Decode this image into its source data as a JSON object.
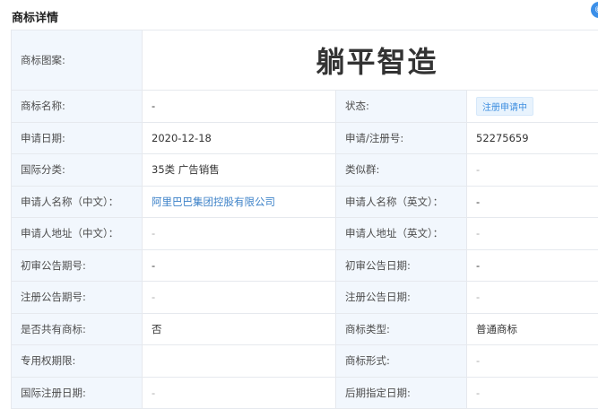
{
  "header": {
    "title": "商标详情",
    "corner_icon": "info-icon"
  },
  "trademark_image": {
    "label": "商标图案:",
    "text": "躺平智造"
  },
  "rows": [
    {
      "l1": "商标名称:",
      "v1": "-",
      "l2": "状态:",
      "v2": "注册申请中"
    },
    {
      "l1": "申请日期:",
      "v1": "2020-12-18",
      "l2": "申请/注册号:",
      "v2": "52275659"
    },
    {
      "l1": "国际分类:",
      "v1": "35类 广告销售",
      "l2": "类似群:",
      "v2": "-"
    },
    {
      "l1": "申请人名称（中文）：",
      "v1": "阿里巴巴集团控股有限公司",
      "l2": "申请人名称（英文）：",
      "v2": "-"
    },
    {
      "l1": "申请人地址（中文）：",
      "v1": "-",
      "l2": "申请人地址（英文）：",
      "v2": "-"
    },
    {
      "l1": "初审公告期号:",
      "v1": "-",
      "l2": "初审公告日期:",
      "v2": "-"
    },
    {
      "l1": "注册公告期号:",
      "v1": "-",
      "l2": "注册公告日期:",
      "v2": "-"
    },
    {
      "l1": "是否共有商标:",
      "v1": "否",
      "l2": "商标类型:",
      "v2": "普通商标"
    },
    {
      "l1": "专用权期限:",
      "v1": "",
      "l2": "商标形式:",
      "v2": "-"
    },
    {
      "l1": "国际注册日期:",
      "v1": "-",
      "l2": "后期指定日期:",
      "v2": "-"
    }
  ],
  "colors": {
    "label_bg": "#f2f7fd",
    "border": "#e6e9ee",
    "link": "#3d82c8",
    "badge": "#3d8ee0"
  }
}
